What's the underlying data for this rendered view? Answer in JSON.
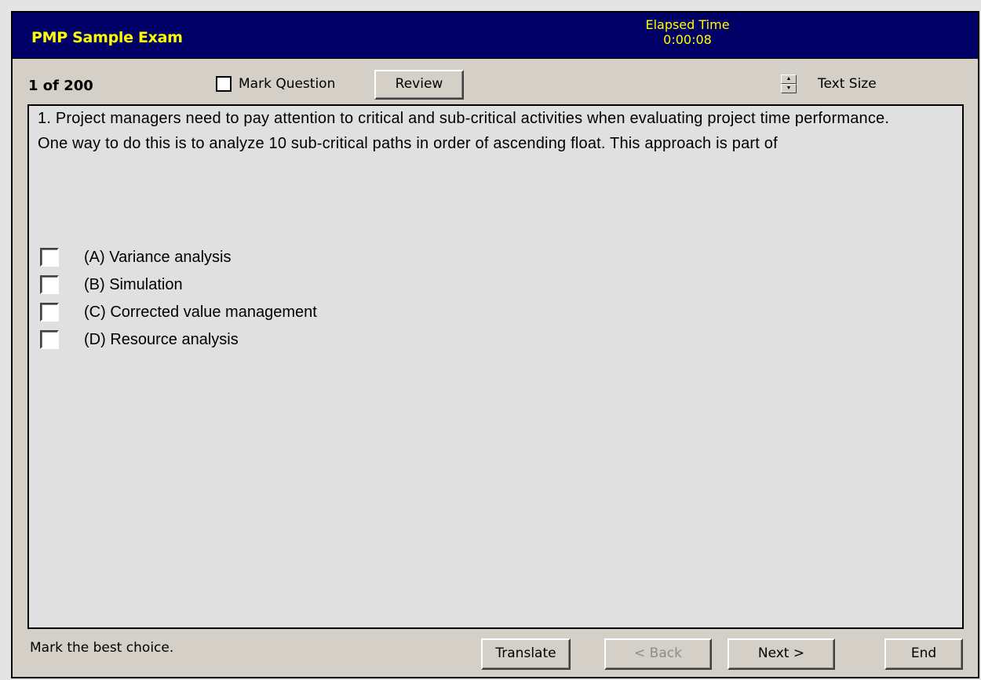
{
  "header": {
    "title": "PMP Sample Exam",
    "elapsed_label": "Elapsed Time",
    "elapsed_value": "0:00:08"
  },
  "toolbar": {
    "counter": "1 of 200",
    "mark_question_label": "Mark Question",
    "review_label": "Review",
    "text_size_label": "Text Size"
  },
  "question": {
    "text": "1. Project managers need to pay attention to critical and sub-critical activities when evaluating project time performance.  One way to do this is to analyze 10 sub-critical paths in order of ascending float.  This approach is part of",
    "options": [
      {
        "label": "(A) Variance analysis",
        "checked": false
      },
      {
        "label": "(B) Simulation",
        "checked": false
      },
      {
        "label": "(C) Corrected value management",
        "checked": false
      },
      {
        "label": "(D) Resource analysis",
        "checked": false
      }
    ]
  },
  "footer": {
    "instruction": "Mark the best choice.",
    "translate_label": "Translate",
    "back_label": "< Back",
    "next_label": "Next >",
    "end_label": "End"
  },
  "colors": {
    "header_bg": "#000066",
    "header_text": "#ffff00",
    "window_bg": "#d4d0c8",
    "content_bg": "#e0e0e0",
    "disabled_text": "#8c8c8c"
  },
  "icons": {
    "text_size_spinner": "up-down-spinner-icon"
  }
}
